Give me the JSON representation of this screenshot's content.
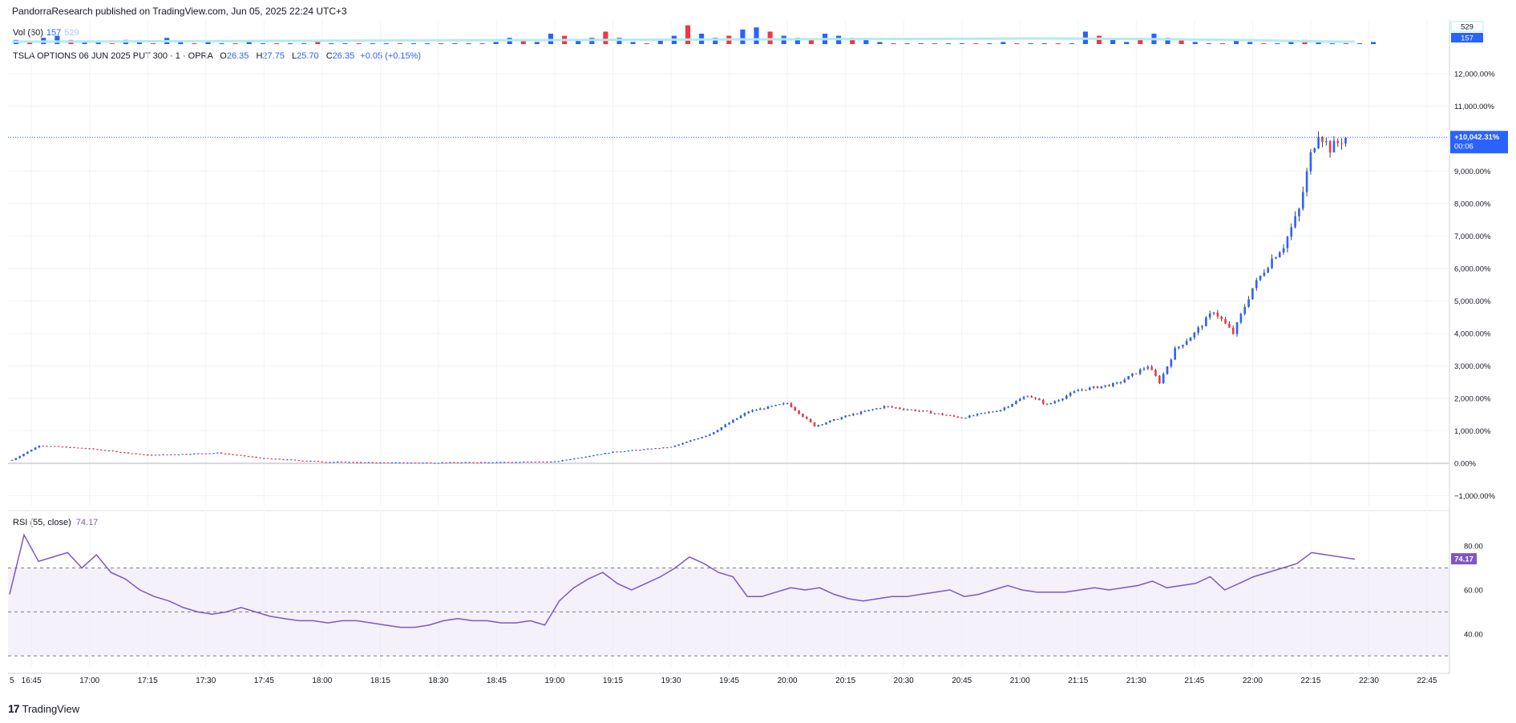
{
  "header": {
    "text": "PandorraResearch published on TradingView.com, Jun 05, 2025 22:24 UTC+3"
  },
  "volume_legend": {
    "label": "Vol (60)",
    "value_a": "157",
    "value_b": "529"
  },
  "ohlc_legend": {
    "symbol": "TSLA OPTIONS 06 JUN 2025 PUT 300 · 1 · OPRA",
    "o_label": "O",
    "o": "26.35",
    "h_label": "H",
    "h": "27.75",
    "l_label": "L",
    "l": "25.70",
    "c_label": "C",
    "c": "26.35",
    "change": "+0.05 (+0.15%)"
  },
  "rsi_legend": {
    "label": "RSI (55, close)",
    "value": "74.17"
  },
  "footer": {
    "brand": "TradingView",
    "logo": "17"
  },
  "colors": {
    "up": "#2962ff",
    "down": "#f23645",
    "rsi": "#7e57c2",
    "vol_ma": "#b2ebf2",
    "price_badge": "#2962ff",
    "rsi_badge": "#7e57c2"
  },
  "chart_data": [
    {
      "type": "candlestick",
      "title": "TSLA OPTIONS 06 JUN 2025 PUT 300 · 1 · OPRA",
      "x_ticks": [
        "5",
        "16:45",
        "17:00",
        "17:15",
        "17:30",
        "17:45",
        "18:00",
        "18:15",
        "18:30",
        "18:45",
        "19:00",
        "19:15",
        "19:30",
        "19:45",
        "20:00",
        "20:15",
        "20:30",
        "20:45",
        "21:00",
        "21:15",
        "21:30",
        "21:45",
        "22:00",
        "22:15",
        "22:30",
        "22:45"
      ],
      "y_ticks": [
        "12,000.00%",
        "11,000.00%",
        "10,000.00%",
        "9,000.00%",
        "8,000.00%",
        "7,000.00%",
        "6,000.00%",
        "5,000.00%",
        "4,000.00%",
        "3,000.00%",
        "2,000.00%",
        "1,000.00%",
        "0.00%",
        "−1,000.00%"
      ],
      "ylim": [
        -1000,
        12000
      ],
      "scale": "percent",
      "price_line": {
        "label": "+10,042.31%",
        "countdown": "00:06",
        "value": 10042.31
      },
      "series_keypoints": [
        {
          "t": "16:40",
          "v": 100
        },
        {
          "t": "16:47",
          "v": 550
        },
        {
          "t": "17:00",
          "v": 450
        },
        {
          "t": "17:15",
          "v": 250
        },
        {
          "t": "17:33",
          "v": 320
        },
        {
          "t": "17:45",
          "v": 150
        },
        {
          "t": "18:00",
          "v": 50
        },
        {
          "t": "18:15",
          "v": 20
        },
        {
          "t": "18:30",
          "v": 20
        },
        {
          "t": "18:45",
          "v": 40
        },
        {
          "t": "19:00",
          "v": 50
        },
        {
          "t": "19:15",
          "v": 350
        },
        {
          "t": "19:30",
          "v": 500
        },
        {
          "t": "19:40",
          "v": 900
        },
        {
          "t": "19:50",
          "v": 1600
        },
        {
          "t": "20:00",
          "v": 1850
        },
        {
          "t": "20:07",
          "v": 1150
        },
        {
          "t": "20:15",
          "v": 1450
        },
        {
          "t": "20:25",
          "v": 1750
        },
        {
          "t": "20:35",
          "v": 1600
        },
        {
          "t": "20:45",
          "v": 1400
        },
        {
          "t": "20:55",
          "v": 1650
        },
        {
          "t": "21:02",
          "v": 2100
        },
        {
          "t": "21:07",
          "v": 1800
        },
        {
          "t": "21:15",
          "v": 2250
        },
        {
          "t": "21:25",
          "v": 2450
        },
        {
          "t": "21:33",
          "v": 3000
        },
        {
          "t": "21:36",
          "v": 2500
        },
        {
          "t": "21:40",
          "v": 3500
        },
        {
          "t": "21:45",
          "v": 4000
        },
        {
          "t": "21:50",
          "v": 4700
        },
        {
          "t": "21:55",
          "v": 4000
        },
        {
          "t": "22:00",
          "v": 5400
        },
        {
          "t": "22:05",
          "v": 6300
        },
        {
          "t": "22:08",
          "v": 6700
        },
        {
          "t": "22:12",
          "v": 7800
        },
        {
          "t": "22:15",
          "v": 9500
        },
        {
          "t": "22:17",
          "v": 10200
        },
        {
          "t": "22:20",
          "v": 9700
        },
        {
          "t": "22:24",
          "v": 10042.31
        }
      ]
    },
    {
      "type": "bar",
      "title": "Vol (60)",
      "current_values": [
        157,
        529
      ],
      "relative_heights": [
        2,
        1,
        3,
        4,
        2,
        1,
        1,
        0,
        2,
        1,
        0,
        3,
        1,
        0,
        1,
        0,
        0,
        1,
        0,
        0,
        0,
        0,
        1,
        0,
        0,
        0,
        0,
        0,
        0,
        0,
        0,
        0,
        0,
        0,
        0,
        1,
        3,
        2,
        1,
        5,
        4,
        2,
        3,
        6,
        3,
        1,
        0,
        2,
        4,
        9,
        5,
        3,
        4,
        7,
        8,
        6,
        4,
        3,
        2,
        5,
        4,
        3,
        2,
        1,
        0,
        0,
        0,
        0,
        0,
        0,
        0,
        0,
        1,
        0,
        0,
        0,
        0,
        0,
        6,
        4,
        2,
        1,
        3,
        5,
        3,
        2,
        1,
        0,
        0,
        2,
        1,
        0,
        0,
        1,
        2,
        1,
        0,
        0,
        0,
        1
      ],
      "ma_label": "529"
    },
    {
      "type": "line",
      "title": "RSI (55, close)",
      "current_value": 74.17,
      "ylim": [
        25,
        95
      ],
      "y_ticks": [
        "80.00",
        "60.00",
        "40.00"
      ],
      "bands": [
        70,
        50,
        30
      ],
      "values": [
        58,
        85,
        73,
        75,
        77,
        70,
        76,
        68,
        65,
        60,
        57,
        55,
        52,
        50,
        49,
        50,
        52,
        50,
        48,
        47,
        46,
        46,
        45,
        46,
        46,
        45,
        44,
        43,
        43,
        44,
        46,
        47,
        46,
        46,
        45,
        45,
        46,
        44,
        55,
        61,
        65,
        68,
        63,
        60,
        63,
        66,
        70,
        75,
        72,
        68,
        66,
        57,
        57,
        59,
        61,
        60,
        61,
        58,
        56,
        55,
        56,
        57,
        57,
        58,
        59,
        60,
        57,
        58,
        60,
        62,
        60,
        59,
        59,
        59,
        60,
        61,
        60,
        61,
        62,
        64,
        61,
        62,
        63,
        66,
        60,
        63,
        66,
        68,
        70,
        72,
        77,
        76,
        75,
        74
      ]
    }
  ]
}
